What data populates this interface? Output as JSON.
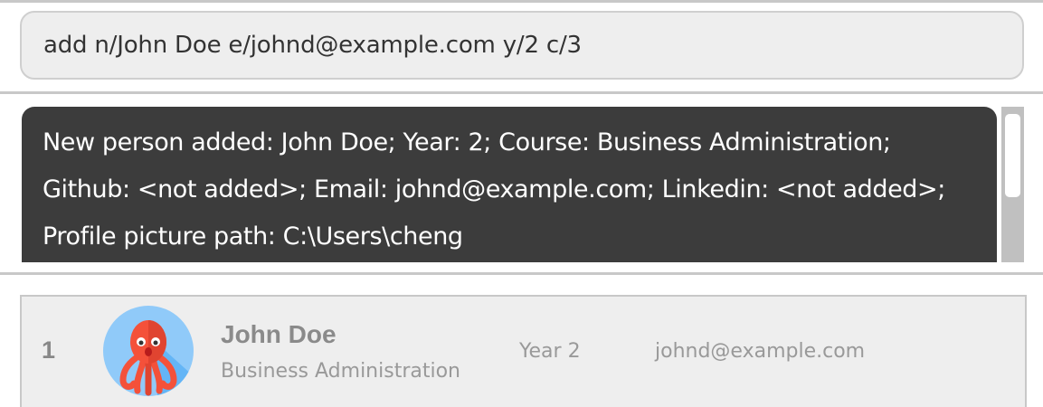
{
  "command_box": {
    "value": "add n/John Doe e/johnd@example.com y/2 c/3"
  },
  "result_display": {
    "text": "New person added: John Doe; Year: 2; Course: Business Administration; Github: <not added>; Email: johnd@example.com; Linkedin: <not added>; Profile picture path: C:\\Users\\cheng"
  },
  "person_list": [
    {
      "index": "1",
      "name": "John Doe",
      "course": "Business Administration",
      "year": "Year 2",
      "email": "johnd@example.com",
      "avatar_icon": "octopus-avatar-icon"
    }
  ],
  "colors": {
    "result_background": "#3c3c3c",
    "card_background": "#eeeeee",
    "avatar_background": "#90caf9",
    "avatar_octopus": "#f4513a"
  }
}
